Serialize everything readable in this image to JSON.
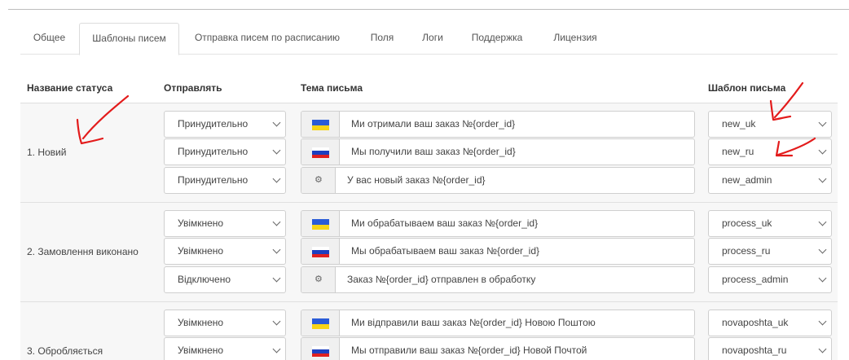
{
  "tabs": [
    {
      "label": "Общее",
      "active": false
    },
    {
      "label": "Шаблоны писем",
      "active": true
    },
    {
      "label": "Отправка писем по расписанию",
      "active": false
    },
    {
      "label": "Поля",
      "active": false
    },
    {
      "label": "Логи",
      "active": false
    },
    {
      "label": "Поддержка",
      "active": false
    },
    {
      "label": "Лицензия",
      "active": false
    }
  ],
  "table": {
    "headers": {
      "status": "Название статуса",
      "send": "Отправлять",
      "subject": "Тема письма",
      "template": "Шаблон письма"
    },
    "groups": [
      {
        "status": "1. Новий",
        "rows": [
          {
            "send": "Принудительно",
            "flag": "ua-flag",
            "subject": "Ми отримали ваш заказ №{order_id}",
            "template": "new_uk"
          },
          {
            "send": "Принудительно",
            "flag": "ru-flag",
            "subject": "Мы получили ваш заказ №{order_id}",
            "template": "new_ru"
          },
          {
            "send": "Принудительно",
            "flag": "gears-icon",
            "subject": "У вас новый заказ №{order_id}",
            "template": "new_admin"
          }
        ]
      },
      {
        "status": "2. Замовлення виконано",
        "rows": [
          {
            "send": "Увімкнено",
            "flag": "ua-flag",
            "subject": "Ми обрабатываем ваш заказ №{order_id}",
            "template": "process_uk"
          },
          {
            "send": "Увімкнено",
            "flag": "ru-flag",
            "subject": "Мы обрабатываем ваш заказ №{order_id}",
            "template": "process_ru"
          },
          {
            "send": "Відключено",
            "flag": "gears-icon",
            "subject": "Заказ №{order_id} отправлен в обработку",
            "template": "process_admin"
          }
        ]
      },
      {
        "status": "3. Обробляється",
        "rows": [
          {
            "send": "Увімкнено",
            "flag": "ua-flag",
            "subject": "Ми відправили ваш заказ №{order_id} Новою Поштою",
            "template": "novaposhta_uk"
          },
          {
            "send": "Увімкнено",
            "flag": "ru-flag",
            "subject": "Мы отправили ваш заказ №{order_id} Новой Почтой",
            "template": "novaposhta_ru"
          }
        ]
      }
    ]
  },
  "annotations": {
    "color": "#e31b1b"
  },
  "icons": {
    "gear": "⚙"
  }
}
